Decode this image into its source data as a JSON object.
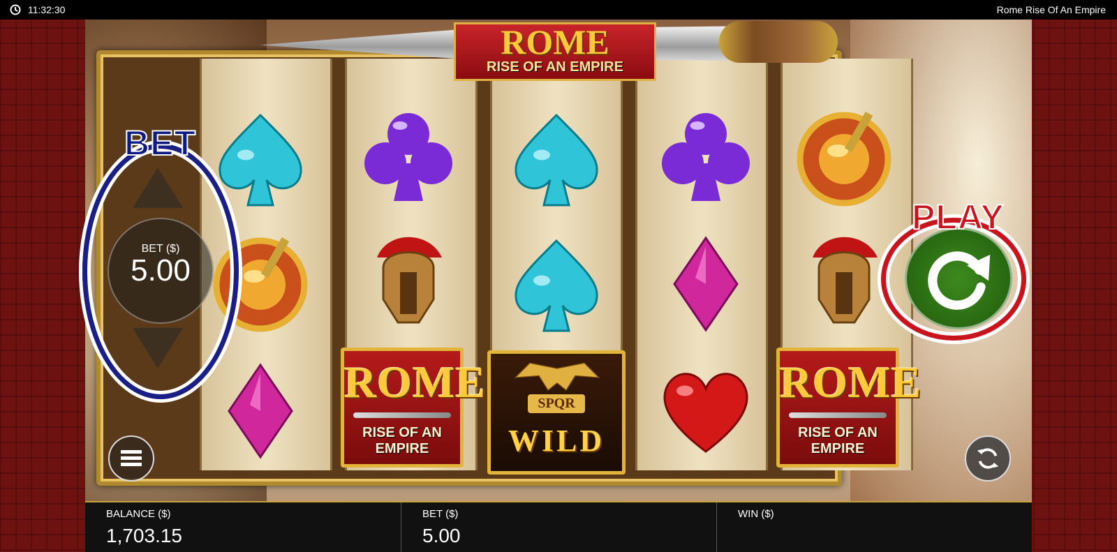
{
  "status_bar": {
    "time": "11:32:30",
    "title": "Rome Rise Of An Empire"
  },
  "banner": {
    "title_main": "ROME",
    "title_sub": "RISE OF AN EMPIRE"
  },
  "reels": [
    [
      "spade-cyan",
      "shield-sword",
      "diamond-pink"
    ],
    [
      "club-purple",
      "gladiator-helmet",
      "rome-logo"
    ],
    [
      "spade-cyan",
      "spade-cyan",
      "wild-eagle"
    ],
    [
      "club-purple",
      "diamond-pink",
      "heart-red"
    ],
    [
      "shield-sword",
      "gladiator-helmet",
      "rome-logo"
    ]
  ],
  "symbol_text": {
    "rome_word": "ROME",
    "rome_sub": "RISE OF AN EMPIRE",
    "wild_badge": "SPQR",
    "wild_word": "WILD"
  },
  "bet_control": {
    "annotation": "BET",
    "label": "BET ($)",
    "value": "5.00"
  },
  "play_control": {
    "annotation": "PLAY"
  },
  "info_bar": {
    "balance_label": "BALANCE ($)",
    "balance_value": "1,703.15",
    "bet_label": "BET ($)",
    "bet_value": "5.00",
    "win_label": "WIN ($)",
    "win_value": ""
  },
  "colors": {
    "bet_annotation": "#1a1f88",
    "play_annotation": "#c8141c",
    "play_button": "#2f7a16",
    "side_panel": "#6d1111"
  }
}
